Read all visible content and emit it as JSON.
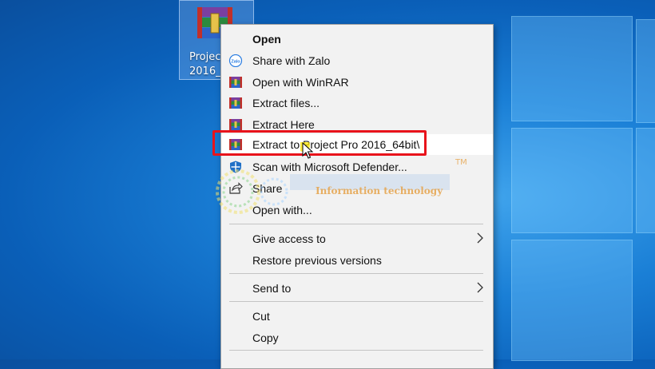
{
  "desktop": {
    "icon_label_line1": "Projec",
    "icon_label_line2": "2016_"
  },
  "menu": {
    "items": [
      {
        "label": "Open",
        "icon": "none"
      },
      {
        "label": "Share with Zalo",
        "icon": "zalo-icon"
      },
      {
        "label": "Open with WinRAR",
        "icon": "winrar-icon"
      },
      {
        "label": "Extract files...",
        "icon": "winrar-icon"
      },
      {
        "label": "Extract Here",
        "icon": "winrar-icon"
      },
      {
        "label": "Extract to Project Pro 2016_64bit\\",
        "icon": "winrar-icon"
      },
      {
        "label": "Scan with Microsoft Defender...",
        "icon": "defender-shield-icon"
      },
      {
        "label": "Share",
        "icon": "share-icon"
      },
      {
        "label": "Open with...",
        "icon": "none"
      },
      {
        "label": "Give access to",
        "icon": "none"
      },
      {
        "label": "Restore previous versions",
        "icon": "none"
      },
      {
        "label": "Send to",
        "icon": "none"
      },
      {
        "label": "Cut",
        "icon": "none"
      },
      {
        "label": "Copy",
        "icon": "none"
      }
    ]
  },
  "watermark": {
    "subtitle": "Information technology",
    "tm": "TM"
  },
  "colors": {
    "highlight_border": "#e8131b",
    "menu_bg": "#f2f2f2",
    "desktop_blue": "#1a7fd6"
  }
}
